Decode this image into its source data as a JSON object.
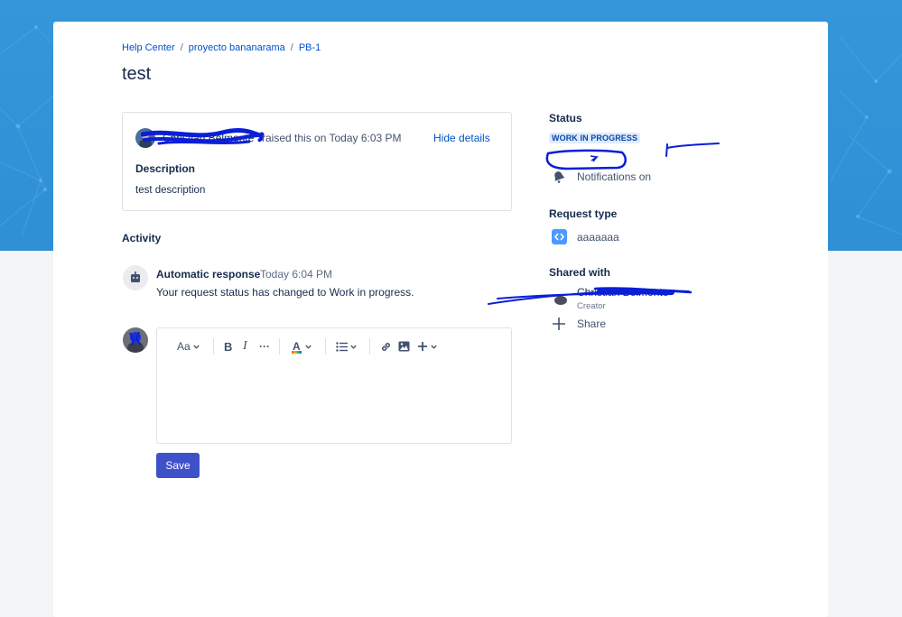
{
  "breadcrumb": {
    "items": [
      "Help Center",
      "proyecto bananarama",
      "PB-1"
    ],
    "separator": "/"
  },
  "request": {
    "title": "test",
    "reporter_name": "Christian Belmonte",
    "raised_text": "raised this on Today 6:03 PM",
    "hide_details_label": "Hide details",
    "description_label": "Description",
    "description_text": "test description"
  },
  "activity": {
    "heading": "Activity",
    "entries": [
      {
        "author": "Automatic response",
        "time": "Today 6:04 PM",
        "message": "Your request status has changed to Work in progress."
      }
    ]
  },
  "editor": {
    "toolbar": {
      "text_style_label": "Aa",
      "bold_label": "B",
      "italic_label": "I",
      "more_label": "···",
      "text_color_label": "A"
    },
    "save_label": "Save"
  },
  "sidebar": {
    "status_label": "Status",
    "status_value": "WORK IN PROGRESS",
    "notifications_label": "Notifications on",
    "request_type_label": "Request type",
    "request_type_value": "aaaaaaa",
    "shared_with_label": "Shared with",
    "shared_user_name": "Christian Belmonte",
    "shared_user_role": "Creator",
    "share_label": "Share"
  },
  "colors": {
    "banner": "#3597d8",
    "link": "#0052cc",
    "primary_button": "#3f51c9",
    "status_lozenge_bg": "#deebff",
    "status_lozenge_text": "#0747a6",
    "annotation_ink": "#0a1fd6"
  },
  "icons": {
    "bot": "robot-icon",
    "notifications": "bell-icon",
    "request_type": "code-brackets-icon",
    "share": "plus-icon"
  }
}
